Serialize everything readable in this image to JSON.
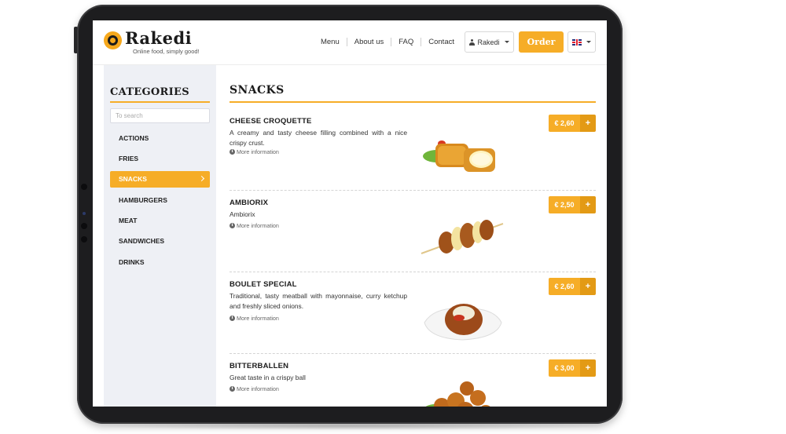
{
  "brand": {
    "name": "Rakedi",
    "tagline": "Online food, simply good!"
  },
  "nav": {
    "items": [
      "Menu",
      "About us",
      "FAQ",
      "Contact"
    ],
    "user_label": "Rakedi",
    "order_label": "Order",
    "language": "English (UK flag)"
  },
  "sidebar": {
    "title": "CATEGORIES",
    "search_placeholder": "To search",
    "items": [
      {
        "label": "ACTIONS"
      },
      {
        "label": "FRIES"
      },
      {
        "label": "SNACKS",
        "active": true
      },
      {
        "label": "HAMBURGERS"
      },
      {
        "label": "MEAT"
      },
      {
        "label": "SANDWICHES"
      },
      {
        "label": "DRINKS"
      }
    ]
  },
  "main": {
    "title": "SNACKS",
    "more_info_label": "More information",
    "products": [
      {
        "name": "CHEESE CROQUETTE",
        "description": "A creamy and tasty cheese filling combined with a nice crispy crust.",
        "price": "€ 2,60"
      },
      {
        "name": "AMBIORIX",
        "description": "Ambiorix",
        "price": "€ 2,50"
      },
      {
        "name": "BOULET SPECIAL",
        "description": "Traditional, tasty meatball with mayonnaise, curry ketchup and freshly sliced onions.",
        "price": "€ 2,60"
      },
      {
        "name": "BITTERBALLEN",
        "description": "Great taste in a crispy ball",
        "price": "€ 3,00"
      }
    ]
  },
  "colors": {
    "accent": "#f6ad27",
    "accent_dark": "#e39a15",
    "sidebar_bg": "#eef0f5",
    "text": "#1b1b1b"
  }
}
